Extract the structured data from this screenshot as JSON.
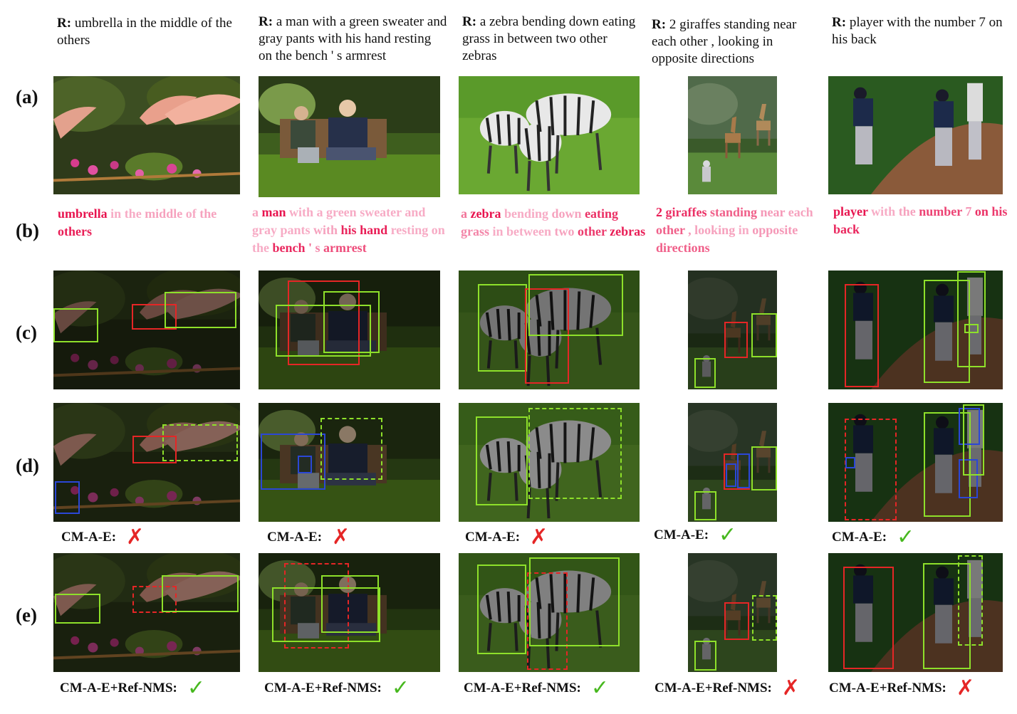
{
  "row_labels": [
    "(a)",
    "(b)",
    "(c)",
    "(d)",
    "(e)"
  ],
  "columns": [
    {
      "caption_prefix": "R:",
      "caption": " umbrella in the middle of the others",
      "words": [
        {
          "t": "umbrella",
          "w": 1.0
        },
        {
          "t": "in",
          "w": 0.2
        },
        {
          "t": "the",
          "w": 0.2
        },
        {
          "t": "middle",
          "w": 0.25
        },
        {
          "t": "of",
          "w": 0.2
        },
        {
          "t": "the",
          "w": 0.25
        },
        {
          "t": "others",
          "w": 0.95
        }
      ],
      "verdict_d": "CM-A-E:",
      "mark_d": "✗",
      "verdict_e": "CM-A-E+Ref-NMS:",
      "mark_e": "✓"
    },
    {
      "caption_prefix": "R:",
      "caption": " a man with a green sweater and gray pants with his hand resting on the bench ' s armrest",
      "words": [
        {
          "t": "a",
          "w": 0.25
        },
        {
          "t": "man",
          "w": 1.0
        },
        {
          "t": "with",
          "w": 0.2
        },
        {
          "t": "a",
          "w": 0.2
        },
        {
          "t": "green",
          "w": 0.2
        },
        {
          "t": "sweater",
          "w": 0.2
        },
        {
          "t": "and",
          "w": 0.2
        },
        {
          "t": "gray",
          "w": 0.2
        },
        {
          "t": "pants",
          "w": 0.2
        },
        {
          "t": "with",
          "w": 0.25
        },
        {
          "t": "his",
          "w": 0.9
        },
        {
          "t": "hand",
          "w": 0.95
        },
        {
          "t": "resting",
          "w": 0.2
        },
        {
          "t": "on",
          "w": 0.2
        },
        {
          "t": "the",
          "w": 0.2
        },
        {
          "t": "bench",
          "w": 0.9
        },
        {
          "t": "'",
          "w": 0.6
        },
        {
          "t": "s",
          "w": 0.4
        },
        {
          "t": "armrest",
          "w": 0.7
        }
      ],
      "verdict_d": "CM-A-E:",
      "mark_d": "✗",
      "verdict_e": "CM-A-E+Ref-NMS:",
      "mark_e": "✓"
    },
    {
      "caption_prefix": "R:",
      "caption": " a zebra bending down eating grass in between two other zebras",
      "words": [
        {
          "t": "a",
          "w": 0.5
        },
        {
          "t": "zebra",
          "w": 1.0
        },
        {
          "t": "bending",
          "w": 0.2
        },
        {
          "t": "down",
          "w": 0.25
        },
        {
          "t": "eating",
          "w": 0.85
        },
        {
          "t": "grass",
          "w": 0.4
        },
        {
          "t": "in",
          "w": 0.2
        },
        {
          "t": "between",
          "w": 0.2
        },
        {
          "t": "two",
          "w": 0.25
        },
        {
          "t": "other",
          "w": 0.8
        },
        {
          "t": "zebras",
          "w": 0.95
        }
      ],
      "verdict_d": "CM-A-E:",
      "mark_d": "✗",
      "verdict_e": "CM-A-E+Ref-NMS:",
      "mark_e": "✓"
    },
    {
      "caption_prefix": "R:",
      "caption": " 2 giraffes standing near each other , looking in opposite directions",
      "words": [
        {
          "t": "2",
          "w": 0.95
        },
        {
          "t": "giraffes",
          "w": 0.85
        },
        {
          "t": "standing",
          "w": 0.6
        },
        {
          "t": "near",
          "w": 0.3
        },
        {
          "t": "each",
          "w": 0.25
        },
        {
          "t": "other",
          "w": 0.6
        },
        {
          "t": ",",
          "w": 0.3
        },
        {
          "t": "looking",
          "w": 0.25
        },
        {
          "t": "in",
          "w": 0.2
        },
        {
          "t": "opposite",
          "w": 0.3
        },
        {
          "t": "directions",
          "w": 0.6
        }
      ],
      "verdict_d": "CM-A-E:",
      "mark_d": "✓",
      "verdict_e": "CM-A-E+Ref-NMS:",
      "mark_e": "✗"
    },
    {
      "caption_prefix": "R:",
      "caption": " player with the number 7 on his back",
      "words": [
        {
          "t": "player",
          "w": 1.0
        },
        {
          "t": "with",
          "w": 0.2
        },
        {
          "t": "the",
          "w": 0.25
        },
        {
          "t": "number",
          "w": 0.75
        },
        {
          "t": "7",
          "w": 0.3
        },
        {
          "t": "on",
          "w": 0.85
        },
        {
          "t": "his",
          "w": 0.8
        },
        {
          "t": "back",
          "w": 0.9
        }
      ],
      "verdict_d": "CM-A-E:",
      "mark_d": "✓",
      "verdict_e": "CM-A-E+Ref-NMS:",
      "mark_e": "✗"
    }
  ],
  "colors": {
    "green_box": "#8ee02a",
    "red_box": "#e52626",
    "blue_box": "#2b47d6",
    "check": "#47b81f",
    "cross": "#e52626",
    "attn_strong": "#e8144f",
    "attn_weak": "#fbd1e3"
  }
}
